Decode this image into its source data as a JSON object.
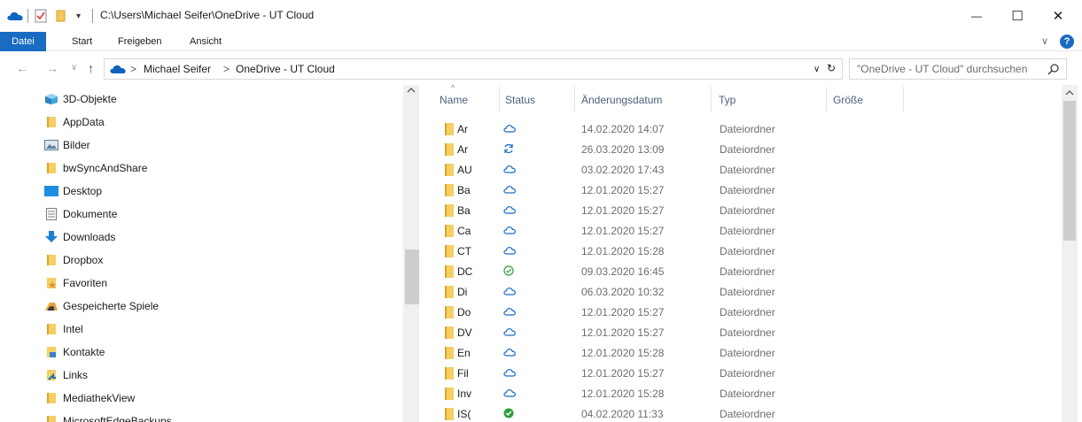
{
  "window": {
    "title": "C:\\Users\\Michael Seifer\\OneDrive - UT Cloud",
    "quick_access_menu": "▾",
    "minimize": "—",
    "maximize": "☐",
    "close": "✕"
  },
  "ribbon": {
    "tabs": [
      "Datei",
      "Start",
      "Freigeben",
      "Ansicht"
    ],
    "expand_chevron": "∨",
    "help": "?"
  },
  "address": {
    "back": "←",
    "forward": "→",
    "recent": "∨",
    "up": "↑",
    "crumbs": [
      "Michael Seifer",
      "OneDrive - UT Cloud"
    ],
    "crumb_separator": ">",
    "dropdown": "∨",
    "refresh": "↻"
  },
  "search": {
    "placeholder": "\"OneDrive - UT Cloud\" durchsuchen"
  },
  "nav": {
    "items": [
      {
        "label": "3D-Objekte",
        "icon": "3d-objects-icon"
      },
      {
        "label": "AppData",
        "icon": "folder-icon"
      },
      {
        "label": "Bilder",
        "icon": "pictures-icon"
      },
      {
        "label": "bwSyncAndShare",
        "icon": "folder-icon"
      },
      {
        "label": "Desktop",
        "icon": "desktop-icon"
      },
      {
        "label": "Dokumente",
        "icon": "documents-icon"
      },
      {
        "label": "Downloads",
        "icon": "downloads-icon"
      },
      {
        "label": "Dropbox",
        "icon": "folder-icon"
      },
      {
        "label": "Favoriten",
        "icon": "favorites-icon"
      },
      {
        "label": "Gespeicherte Spiele",
        "icon": "saved-games-icon"
      },
      {
        "label": "Intel",
        "icon": "folder-icon"
      },
      {
        "label": "Kontakte",
        "icon": "contacts-icon"
      },
      {
        "label": "Links",
        "icon": "links-icon"
      },
      {
        "label": "MediathekView",
        "icon": "folder-icon"
      },
      {
        "label": "MicrosoftEdgeBackups",
        "icon": "folder-icon"
      }
    ]
  },
  "list": {
    "sort_indicator": "^",
    "columns": [
      "Name",
      "Status",
      "Änderungsdatum",
      "Typ",
      "Größe"
    ],
    "rows": [
      {
        "name": "Ar",
        "status": "cloud",
        "date": "14.02.2020 14:07",
        "type": "Dateiordner"
      },
      {
        "name": "Ar",
        "status": "syncing",
        "date": "26.03.2020 13:09",
        "type": "Dateiordner"
      },
      {
        "name": "AU",
        "status": "cloud",
        "date": "03.02.2020 17:43",
        "type": "Dateiordner"
      },
      {
        "name": "Ba",
        "status": "cloud",
        "date": "12.01.2020 15:27",
        "type": "Dateiordner"
      },
      {
        "name": "Ba",
        "status": "cloud",
        "date": "12.01.2020 15:27",
        "type": "Dateiordner"
      },
      {
        "name": "Ca",
        "status": "cloud",
        "date": "12.01.2020 15:27",
        "type": "Dateiordner"
      },
      {
        "name": "CT",
        "status": "cloud",
        "date": "12.01.2020 15:28",
        "type": "Dateiordner"
      },
      {
        "name": "DC",
        "status": "available",
        "date": "09.03.2020 16:45",
        "type": "Dateiordner"
      },
      {
        "name": "Di",
        "status": "cloud",
        "date": "06.03.2020 10:32",
        "type": "Dateiordner"
      },
      {
        "name": "Do",
        "status": "cloud",
        "date": "12.01.2020 15:27",
        "type": "Dateiordner"
      },
      {
        "name": "DV",
        "status": "cloud",
        "date": "12.01.2020 15:27",
        "type": "Dateiordner"
      },
      {
        "name": "En",
        "status": "cloud",
        "date": "12.01.2020 15:28",
        "type": "Dateiordner"
      },
      {
        "name": "Fil",
        "status": "cloud",
        "date": "12.01.2020 15:27",
        "type": "Dateiordner"
      },
      {
        "name": "Inv",
        "status": "cloud",
        "date": "12.01.2020 15:28",
        "type": "Dateiordner"
      },
      {
        "name": "IS(",
        "status": "always-available",
        "date": "04.02.2020 11:33",
        "type": "Dateiordner"
      }
    ]
  },
  "colors": {
    "accent": "#1a6bc2",
    "cloud_status": "#1a6bc2",
    "available_status": "#2e9e3a"
  }
}
